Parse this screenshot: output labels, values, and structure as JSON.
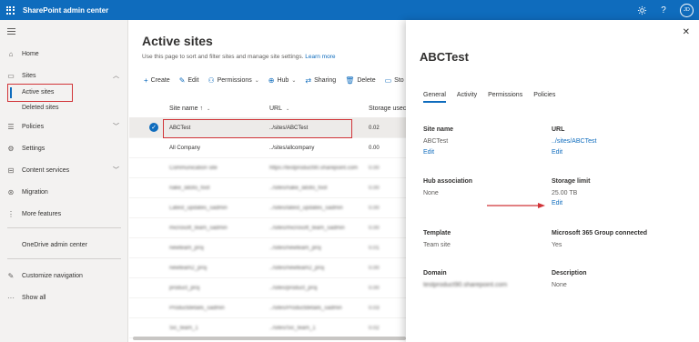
{
  "topbar": {
    "app_title": "SharePoint admin center",
    "avatar_initials": "JD",
    "icons": [
      "waffle-icon",
      "gear-icon",
      "help-icon"
    ]
  },
  "nav": {
    "items": [
      {
        "label": "Home",
        "icon": "home-icon"
      },
      {
        "label": "Sites",
        "icon": "sites-icon",
        "expanded": true,
        "children": [
          {
            "label": "Active sites",
            "active": true
          },
          {
            "label": "Deleted sites"
          }
        ]
      },
      {
        "label": "Policies",
        "icon": "policies-icon"
      },
      {
        "label": "Settings",
        "icon": "gear-icon"
      },
      {
        "label": "Content services",
        "icon": "content-services-icon"
      },
      {
        "label": "Migration",
        "icon": "migration-icon"
      },
      {
        "label": "More features",
        "icon": "more-features-icon"
      },
      {
        "label": "OneDrive admin center",
        "icon": "onedrive-icon"
      },
      {
        "label": "Customize navigation",
        "icon": "pencil-icon"
      },
      {
        "label": "Show all",
        "icon": "ellipsis-icon"
      }
    ]
  },
  "main": {
    "title": "Active sites",
    "description": "Use this page to sort and filter sites and manage site settings.",
    "learn_more": "Learn more",
    "commands": [
      "Create",
      "Edit",
      "Permissions",
      "Hub",
      "Sharing",
      "Delete",
      "Sto"
    ],
    "columns": {
      "site_name": "Site name",
      "sort_indicator": "↑",
      "url": "URL",
      "storage": "Storage usec"
    },
    "rows": [
      {
        "name": "ABCTest",
        "url": "../sites/ABCTest",
        "storage": "0.02",
        "selected": true,
        "blurred": false
      },
      {
        "name": "All Company",
        "url": "../sites/allcompany",
        "storage": "0.00",
        "selected": false,
        "blurred": false
      },
      {
        "name": "Communication site",
        "url": "https://testproduct90.sharepoint.com",
        "storage": "0.00",
        "selected": false,
        "blurred": true
      },
      {
        "name": "nake_latoto_foot",
        "url": "../sites/nake_latoto_foot",
        "storage": "0.00",
        "selected": false,
        "blurred": true
      },
      {
        "name": "Latest_updates_sadmin",
        "url": "../sites/latest_updates_sadmin",
        "storage": "0.00",
        "selected": false,
        "blurred": true
      },
      {
        "name": "microsoft_team_sadmin",
        "url": "../sites/microsoft_team_sadmin",
        "storage": "0.00",
        "selected": false,
        "blurred": true
      },
      {
        "name": "newteam_proj",
        "url": "../sites/newteam_proj",
        "storage": "0.01",
        "selected": false,
        "blurred": true
      },
      {
        "name": "newteam2_proj",
        "url": "../sites/newteam2_proj",
        "storage": "0.00",
        "selected": false,
        "blurred": true
      },
      {
        "name": "product_proj",
        "url": "../sites/product_proj",
        "storage": "0.00",
        "selected": false,
        "blurred": true
      },
      {
        "name": "Productdetails_sadmin",
        "url": "../sites/Productdetails_sadmin",
        "storage": "0.03",
        "selected": false,
        "blurred": true
      },
      {
        "name": "Sic_team_1",
        "url": "../sites/Sic_team_1",
        "storage": "0.02",
        "selected": false,
        "blurred": true
      }
    ]
  },
  "panel": {
    "title": "ABCTest",
    "tabs": [
      "General",
      "Activity",
      "Permissions",
      "Policies"
    ],
    "active_tab": "General",
    "fields": {
      "site_name_label": "Site name",
      "site_name_value": "ABCTest",
      "site_name_edit": "Edit",
      "url_label": "URL",
      "url_value": "../sites/ABCTest",
      "url_edit": "Edit",
      "hub_label": "Hub association",
      "hub_value": "None",
      "storage_label": "Storage limit",
      "storage_value": "25.00 TB",
      "storage_edit": "Edit",
      "template_label": "Template",
      "template_value": "Team site",
      "m365_label": "Microsoft 365 Group connected",
      "m365_value": "Yes",
      "domain_label": "Domain",
      "domain_value": "testproduct90.sharepoint.com",
      "description_label": "Description",
      "description_value": "None"
    }
  },
  "colors": {
    "brand": "#0f6cbd",
    "annotation_red": "#d13438"
  }
}
